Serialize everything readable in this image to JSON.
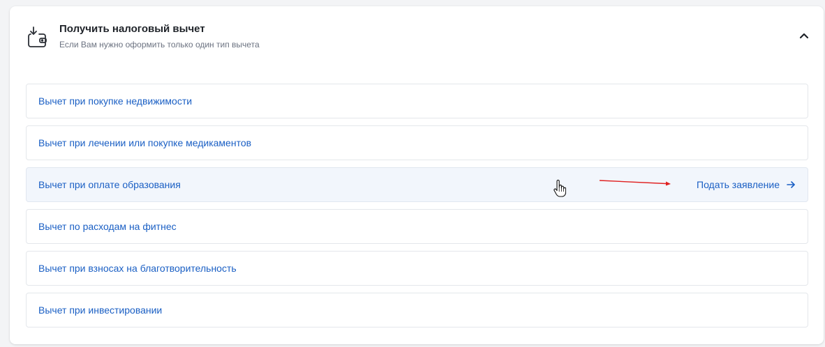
{
  "panel": {
    "title": "Получить налоговый вычет",
    "subtitle": "Если Вам нужно оформить только один тип вычета",
    "icon": "wallet-download-icon",
    "collapse_icon": "chevron-up-icon"
  },
  "deductions": [
    {
      "label": "Вычет при покупке недвижимости"
    },
    {
      "label": "Вычет при лечении или покупке медикаментов"
    },
    {
      "label": "Вычет при оплате образования",
      "action": "Подать заявление"
    },
    {
      "label": "Вычет по расходам на фитнес"
    },
    {
      "label": "Вычет при взносах на благотворительность"
    },
    {
      "label": "Вычет при инвестировании"
    }
  ],
  "colors": {
    "link": "#1a5fc4",
    "hover_bg": "#f2f6fc",
    "annotation_arrow": "#e02020"
  }
}
